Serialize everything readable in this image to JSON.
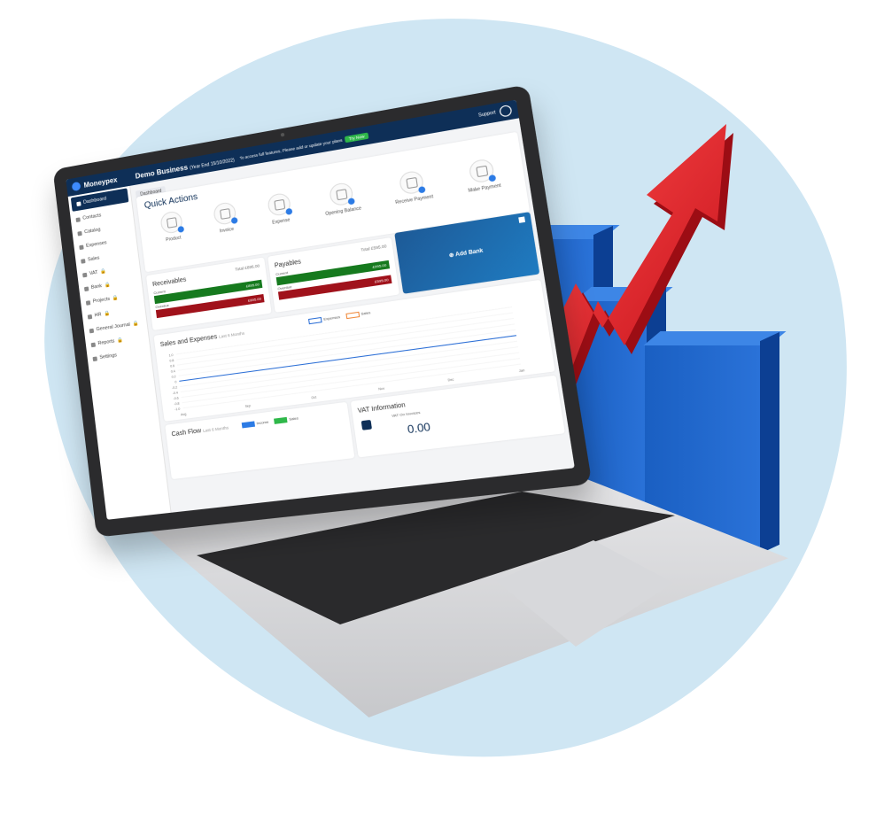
{
  "app": {
    "brand": "Moneypex",
    "business": "Demo Business",
    "year_end": "(Year End 15/10/2022)",
    "notice": "To access full features, Please add or update your plans",
    "try_now": "Try Now",
    "support": "Support"
  },
  "sidebar": {
    "items": [
      {
        "label": "Dashboard",
        "icon": "dashboard-icon",
        "active": true
      },
      {
        "label": "Contacts",
        "icon": "user-icon"
      },
      {
        "label": "Catalog",
        "icon": "catalog-icon"
      },
      {
        "label": "Expenses",
        "icon": "expense-icon"
      },
      {
        "label": "Sales",
        "icon": "cart-icon"
      },
      {
        "label": "VAT",
        "icon": "vat-icon",
        "locked": true
      },
      {
        "label": "Bank",
        "icon": "bank-icon",
        "locked": true
      },
      {
        "label": "Projects",
        "icon": "projects-icon",
        "locked": true
      },
      {
        "label": "HR",
        "icon": "people-icon",
        "locked": true
      },
      {
        "label": "General Journal",
        "icon": "journal-icon",
        "locked": true
      },
      {
        "label": "Reports",
        "icon": "report-icon",
        "locked": true
      },
      {
        "label": "Settings",
        "icon": "gear-icon"
      }
    ]
  },
  "breadcrumb": "Dashboard",
  "quick_actions": {
    "title": "Quick Actions",
    "items": [
      "Product",
      "Invoice",
      "Expense",
      "Opening Balance",
      "Receive Payment",
      "Make Payment"
    ]
  },
  "receivables": {
    "title": "Receivables",
    "total": "Total £895.00",
    "current_label": "Current",
    "current_value": "£895.00",
    "overdue_label": "Overdue",
    "overdue_value": "£895.00"
  },
  "payables": {
    "title": "Payables",
    "total": "Total £595.00",
    "current_label": "Current",
    "current_value": "£995.00",
    "overdue_label": "Overdue",
    "overdue_value": "£595.00"
  },
  "bank": {
    "add_label": "Add Bank"
  },
  "sales_expenses": {
    "title": "Sales and Expenses",
    "period": "Last 6 Months",
    "legend": [
      "Expenses",
      "Sales"
    ]
  },
  "chart_data": {
    "type": "line",
    "title": "Sales and Expenses",
    "categories": [
      "Aug",
      "Sep",
      "Oct",
      "Nov",
      "Dec",
      "Jan"
    ],
    "series": [
      {
        "name": "Expenses",
        "values": [
          0,
          0,
          0,
          0,
          0,
          0
        ]
      }
    ],
    "ylim": [
      -1.0,
      1.0
    ],
    "yticks": [
      "1.0",
      "0.8",
      "0.6",
      "0.4",
      "0.2",
      "0",
      "-0.2",
      "-0.4",
      "-0.6",
      "-0.8",
      "-1.0"
    ],
    "colors": {
      "Expenses": "#2c6fd6",
      "Sales": "#f08a3c"
    }
  },
  "cash_flow": {
    "title": "Cash Flow",
    "period": "Last 6 Months",
    "legend": [
      "Income",
      "Sales"
    ]
  },
  "vat": {
    "title": "VAT Information",
    "subtitle": "VAT On Invoices",
    "value": "0.00"
  }
}
